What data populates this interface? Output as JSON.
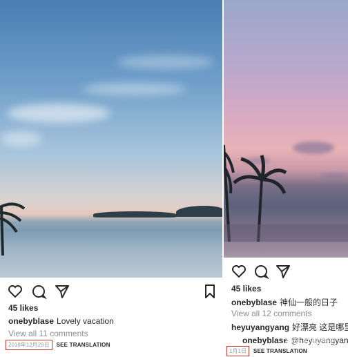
{
  "left_post": {
    "likes": "45 likes",
    "caption_user": "onebyblase",
    "caption_text": "Lovely vacation",
    "view_comments": "View all 11 comments",
    "date": "2018年12月29日",
    "see_translation": "SEE TRANSLATION"
  },
  "right_post": {
    "likes": "45 likes",
    "caption_user": "onebyblase",
    "caption_text": "神仙一般的日子",
    "view_comments": "View all 12 comments",
    "comment1_user": "heyuyangyang",
    "comment1_text": "好漂亮 这是哪里鸭",
    "comment2_user": "onebyblase",
    "comment2_text": "@heyuyangyang 泰",
    "date": "1月1日",
    "see_translation": "SEE TRANSLATION",
    "watermark": "知乎 @钢琴男"
  },
  "icons": [
    "heart-icon",
    "comment-icon",
    "share-icon",
    "bookmark-icon"
  ]
}
